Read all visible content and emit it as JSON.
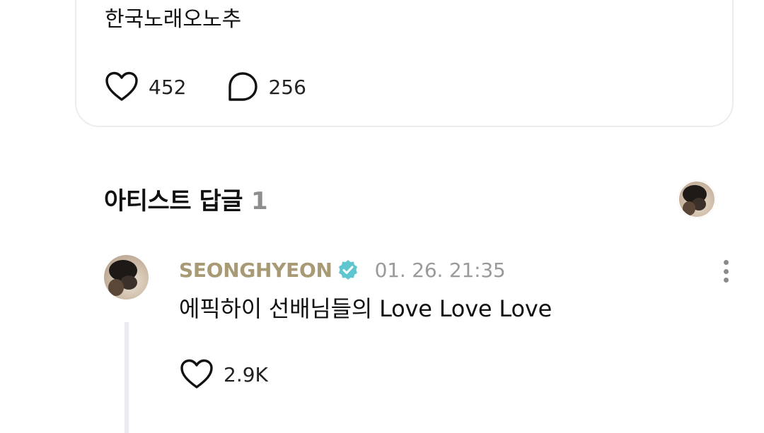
{
  "post": {
    "text": "한국노래오노추",
    "like_count": "452",
    "comment_count": "256"
  },
  "artist_replies": {
    "title": "아티스트 답글",
    "count": "1"
  },
  "reply": {
    "author": "SEONGHYEON",
    "timestamp": "01. 26. 21:35",
    "text": "에픽하이 선배님들의 Love Love Love",
    "like_count": "2.9K"
  },
  "colors": {
    "artist_name": "#a89a74",
    "verified_badge": "#5fc6cf",
    "muted_text": "#9a9a9a",
    "card_border": "#ececec"
  },
  "icons": {
    "like": "heart-outline-icon",
    "comment": "speech-bubble-icon",
    "verified": "verified-badge-icon",
    "more": "more-vertical-icon"
  }
}
